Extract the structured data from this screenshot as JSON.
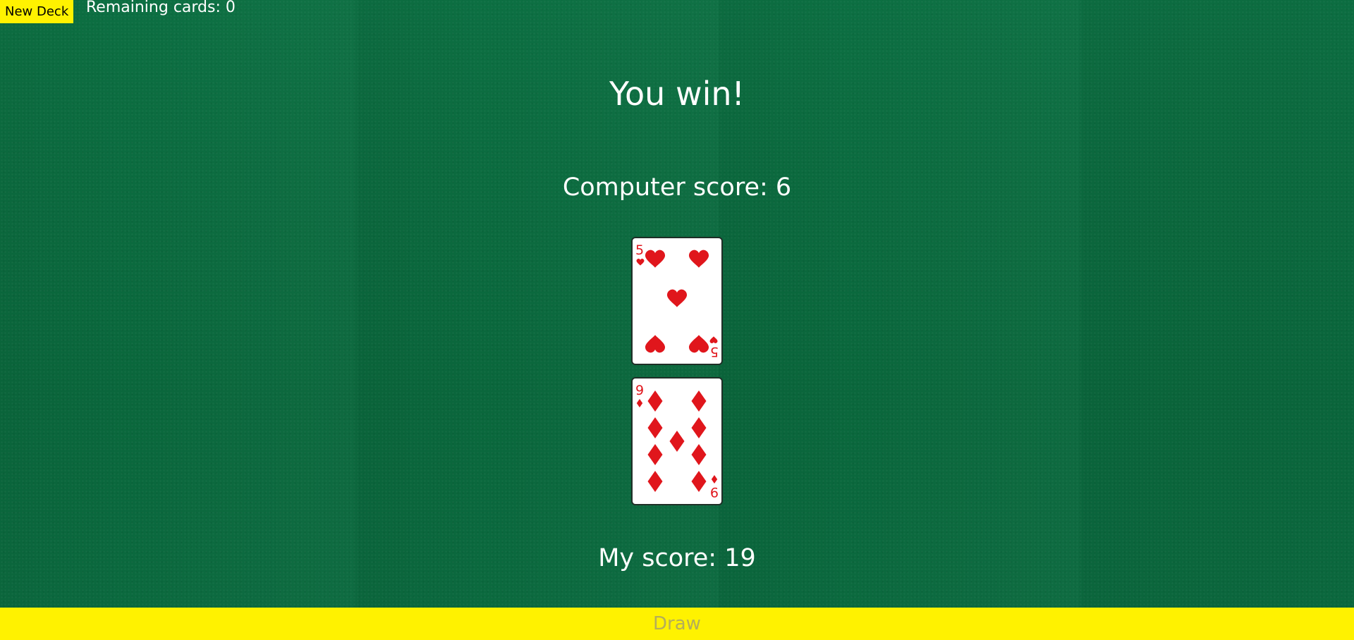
{
  "header": {
    "new_deck_label": "New Deck",
    "remaining_label": "Remaining cards: 0"
  },
  "game": {
    "result": "You win!",
    "computer_score": "Computer score: 6",
    "my_score": "My score: 19"
  },
  "cards": {
    "computer_card": {
      "rank": "5",
      "suit": "hearts",
      "icon": "heart-icon"
    },
    "player_card": {
      "rank": "9",
      "suit": "diamonds",
      "icon": "diamond-icon"
    }
  },
  "controls": {
    "draw_label": "Draw"
  },
  "colors": {
    "felt": "#0b6b3f",
    "button_yellow": "#fff200",
    "card_red": "#e0161c",
    "draw_text_disabled": "#b4ad5a"
  }
}
